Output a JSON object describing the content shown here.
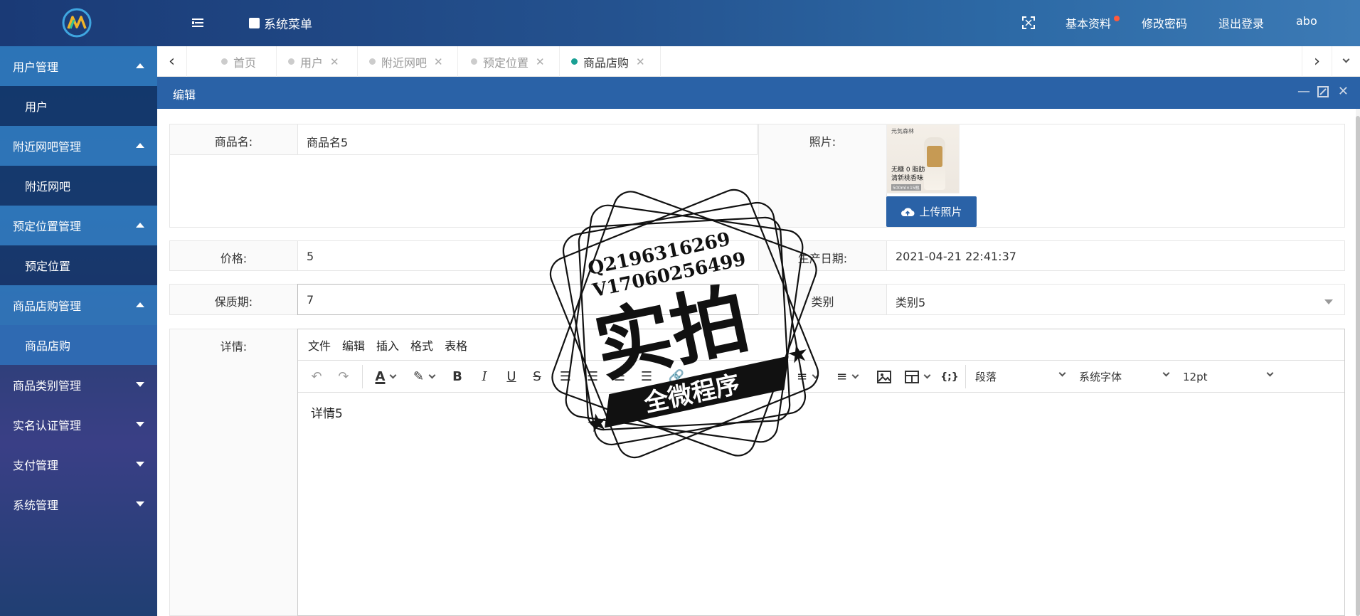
{
  "header": {
    "menu_title": "系统菜单",
    "right_links": [
      "基本资料",
      "修改密码",
      "退出登录",
      "abo"
    ]
  },
  "sidebar": {
    "groups": [
      {
        "label": "用户管理",
        "open": true,
        "items": [
          "用户"
        ]
      },
      {
        "label": "附近网吧管理",
        "open": true,
        "items": [
          "附近网吧"
        ]
      },
      {
        "label": "预定位置管理",
        "open": true,
        "items": [
          "预定位置"
        ]
      },
      {
        "label": "商品店购管理",
        "open": true,
        "items": [
          "商品店购"
        ]
      },
      {
        "label": "商品类别管理",
        "open": false,
        "items": []
      },
      {
        "label": "实名认证管理",
        "open": false,
        "items": []
      },
      {
        "label": "支付管理",
        "open": false,
        "items": []
      },
      {
        "label": "系统管理",
        "open": false,
        "items": []
      }
    ],
    "active_item": "商品店购"
  },
  "tabs": [
    {
      "label": "首页",
      "closable": false,
      "active": false
    },
    {
      "label": "用户",
      "closable": true,
      "active": false
    },
    {
      "label": "附近网吧",
      "closable": true,
      "active": false
    },
    {
      "label": "预定位置",
      "closable": true,
      "active": false
    },
    {
      "label": "商品店购",
      "closable": true,
      "active": true
    }
  ],
  "dialog": {
    "title": "编辑"
  },
  "form": {
    "name_label": "商品名:",
    "name_value": "商品名5",
    "photo_label": "照片:",
    "upload_label": "上传照片",
    "price_label": "价格:",
    "price_value": "5",
    "date_label": "生产日期:",
    "date_value": "2021-04-21 22:41:37",
    "shelf_label": "保质期:",
    "shelf_value": "7",
    "category_label": "类别",
    "category_value": "类别5",
    "detail_label": "详情:"
  },
  "photo": {
    "brand": "元気森林",
    "line1": "无糖 0 脂肪",
    "line2": "清新桃香味",
    "line3": "500ml×15瓶"
  },
  "editor": {
    "menus": [
      "文件",
      "编辑",
      "插入",
      "格式",
      "表格"
    ],
    "block_format": "段落",
    "font_family": "系统字体",
    "font_size": "12pt",
    "body": "详情5"
  },
  "watermark": {
    "line1": "Q2196316269",
    "line2": "V17060256499",
    "big": "实拍",
    "banner": "全微程序"
  },
  "colors": {
    "primary": "#2a62a7",
    "active_tab_dot": "#1aa094",
    "badge": "#ff5a3c"
  }
}
